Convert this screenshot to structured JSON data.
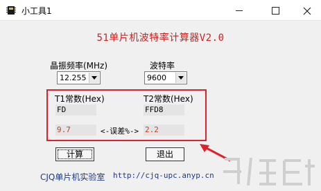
{
  "window": {
    "title": "小工具1"
  },
  "heading": "51单片机波特率计算器V2.0",
  "crystal": {
    "label": "晶振频率(MHz)",
    "value": "12.255"
  },
  "baud": {
    "label": "波特率",
    "value": "9600"
  },
  "t1": {
    "label": "T1常数(Hex)",
    "value": "FD"
  },
  "t2": {
    "label": "T2常数(Hex)",
    "value": "FFD8"
  },
  "error": {
    "label": "<-误差%->",
    "t1_value": "9.7",
    "t2_value": "2.2"
  },
  "buttons": {
    "calculate": "计算",
    "exit": "退出"
  },
  "footer": {
    "lab": "CJQ单片机实验室",
    "url": "http://cjq-upc.anyp.cn"
  },
  "colors": {
    "heading": "#d02020",
    "highlight_frame": "#e0202a",
    "footer": "#1a3a8a"
  }
}
